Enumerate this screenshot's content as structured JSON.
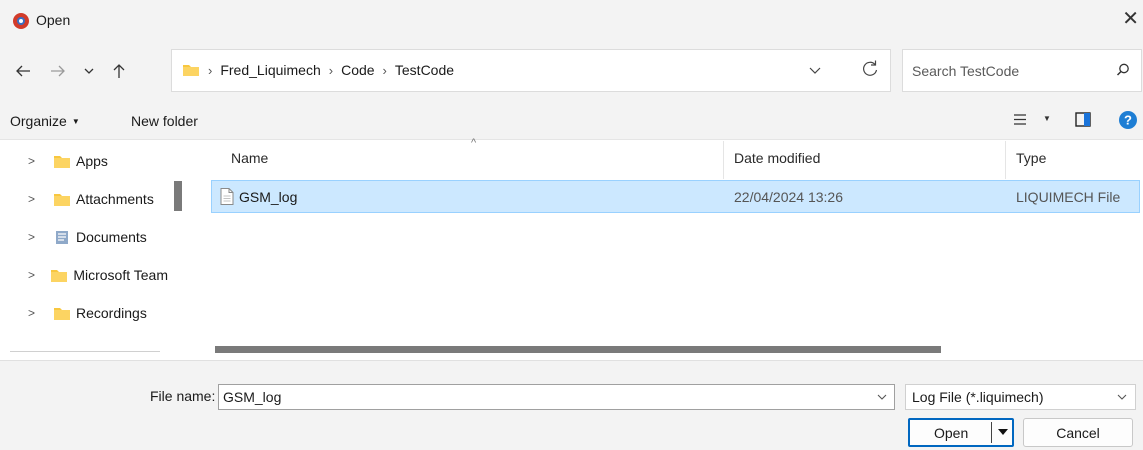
{
  "window": {
    "title": "Open"
  },
  "navigation": {
    "path": [
      "Fred_Liquimech",
      "Code",
      "TestCode"
    ],
    "search_placeholder": "Search TestCode"
  },
  "toolbar": {
    "organize_label": "Organize",
    "new_folder_label": "New folder"
  },
  "sidebar": {
    "items": [
      {
        "label": "Apps",
        "icon": "folder-icon"
      },
      {
        "label": "Attachments",
        "icon": "folder-icon"
      },
      {
        "label": "Documents",
        "icon": "documents-icon"
      },
      {
        "label": "Microsoft Team",
        "icon": "folder-icon"
      },
      {
        "label": "Recordings",
        "icon": "folder-icon"
      }
    ]
  },
  "file_list": {
    "columns": [
      "Name",
      "Date modified",
      "Type"
    ],
    "rows": [
      {
        "name": "GSM_log",
        "date_modified": "22/04/2024 13:26",
        "type": "LIQUIMECH File",
        "selected": true
      }
    ]
  },
  "footer": {
    "file_name_label": "File name:",
    "file_name_value": "GSM_log",
    "file_type_value": "Log File (*.liquimech)",
    "open_label": "Open",
    "cancel_label": "Cancel"
  },
  "colors": {
    "selection": "#cce8ff",
    "accent": "#0067c0",
    "folder": "#f8c73f"
  }
}
